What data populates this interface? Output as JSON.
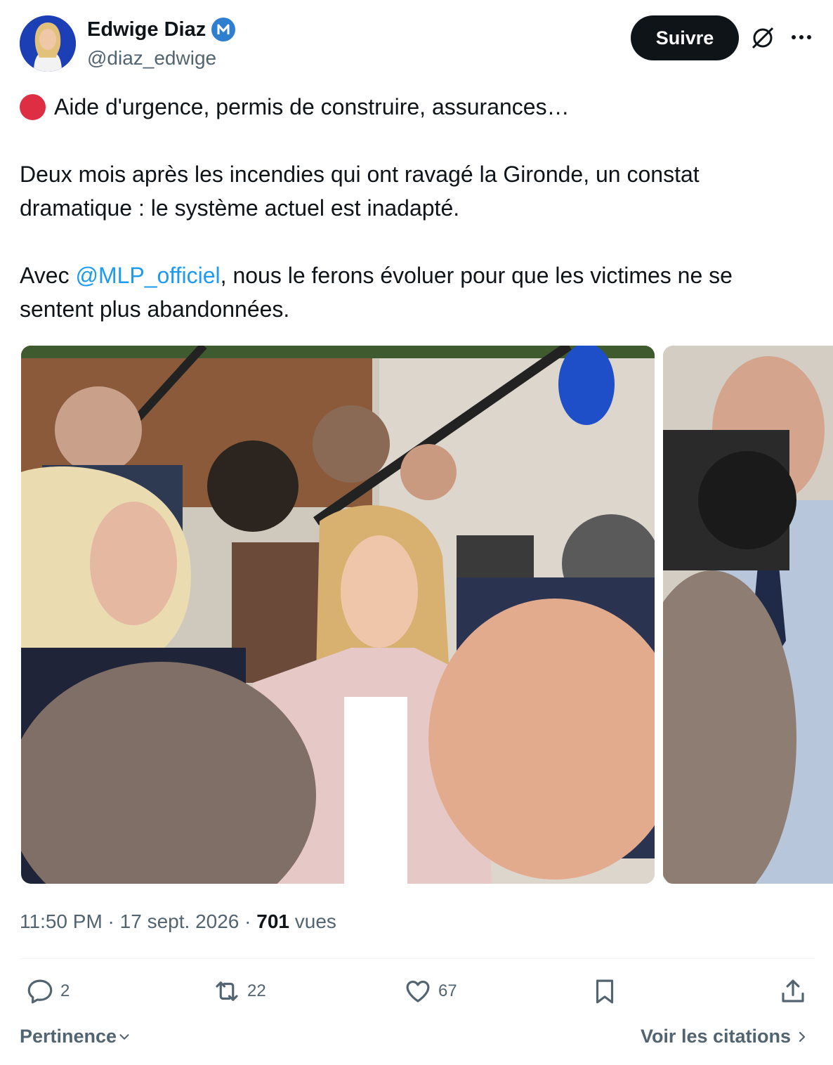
{
  "author": {
    "name": "Edwige Diaz",
    "handle": "@diaz_edwige"
  },
  "header": {
    "follow_label": "Suivre"
  },
  "tweet": {
    "line1": "Aide d'urgence, permis de construire, assurances…",
    "para2": "Deux mois après les incendies qui ont ravagé la Gironde, un constat dramatique : le système actuel est inadapté.",
    "para3_prefix": "Avec ",
    "mention": "@MLP_officiel",
    "para3_suffix": ", nous le ferons évoluer pour que les victimes ne se sentent plus abandonnées."
  },
  "meta": {
    "time": "11:50 PM",
    "sep": " · ",
    "date": "17 sept. 2026",
    "views_count": "701",
    "views_label": " vues"
  },
  "actions": {
    "replies": "2",
    "reposts": "22",
    "likes": "67"
  },
  "footer": {
    "sort_label": "Pertinence",
    "quotes_label": "Voir les citations"
  },
  "colors": {
    "accent": "#1d9bf0",
    "text": "#0f1419",
    "secondary": "#536471",
    "alert_dot": "#dd2e44"
  }
}
